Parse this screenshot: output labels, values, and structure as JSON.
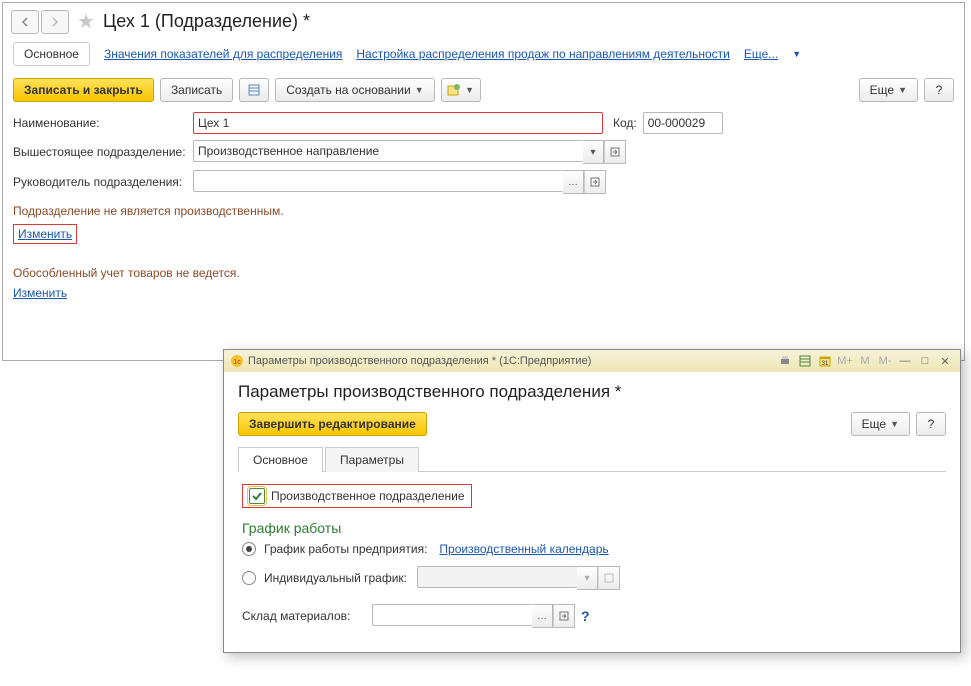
{
  "header": {
    "title": "Цех 1 (Подразделение) *"
  },
  "tabs": {
    "main": "Основное",
    "values": "Значения показателей для распределения",
    "sales_cfg": "Настройка распределения продаж по направлениям деятельности",
    "more": "Еще..."
  },
  "toolbar": {
    "save_close": "Записать и закрыть",
    "save": "Записать",
    "create_based": "Создать на основании",
    "more": "Еще"
  },
  "form": {
    "name_label": "Наименование:",
    "name_value": "Цех 1",
    "code_label": "Код:",
    "code_value": "00-000029",
    "parent_label": "Вышестоящее подразделение:",
    "parent_value": "Производственное направление",
    "manager_label": "Руководитель подразделения:",
    "manager_value": "",
    "prod_note": "Подразделение не является производственным.",
    "change": "Изменить",
    "sep_note": "Обособленный учет товаров не ведется."
  },
  "modal": {
    "caption": "Параметры производственного подразделения * (1С:Предприятие)",
    "title": "Параметры производственного подразделения *",
    "finish": "Завершить редактирование",
    "more": "Еще",
    "tab_main": "Основное",
    "tab_params": "Параметры",
    "prod_check": "Производственное подразделение",
    "schedule_h": "График работы",
    "r_company": "График работы предприятия:",
    "calendar_link": "Производственный календарь",
    "r_individual": "Индивидуальный график:",
    "materials_label": "Склад материалов:"
  }
}
